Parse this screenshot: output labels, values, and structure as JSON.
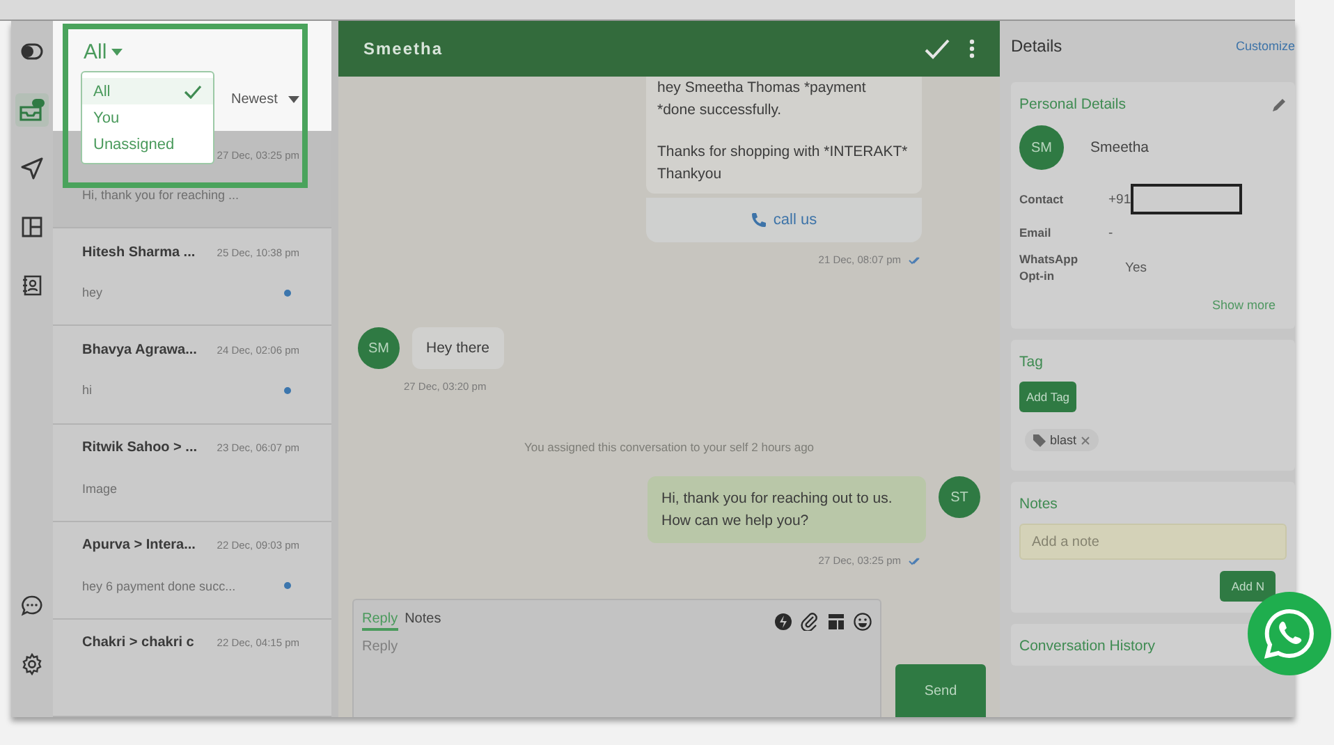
{
  "rail": [
    {
      "kind": "toggle",
      "selected": false
    },
    {
      "kind": "inbox",
      "selected": true
    },
    {
      "kind": "send",
      "selected": false
    },
    {
      "kind": "layout",
      "selected": false
    },
    {
      "kind": "contacts",
      "selected": false
    },
    {
      "kind": "chat",
      "selected": false
    },
    {
      "kind": "settings",
      "selected": false
    }
  ],
  "filter": {
    "label": "All",
    "options": [
      {
        "label": "All",
        "selected": true
      },
      {
        "label": "You",
        "selected": false
      },
      {
        "label": "Unassigned",
        "selected": false
      }
    ]
  },
  "sort": {
    "label": "Newest"
  },
  "conversations": [
    {
      "time": "27 Dec, 03:25 pm",
      "preview": "Hi, thank you for reaching ...",
      "unread": false,
      "selected": true
    },
    {
      "name": "Hitesh Sharma ...",
      "time": "25 Dec, 10:38 pm",
      "preview": "hey",
      "unread": true,
      "selected": false
    },
    {
      "name": "Bhavya Agrawa...",
      "time": "24 Dec, 02:06 pm",
      "preview": "hi",
      "unread": true,
      "selected": false
    },
    {
      "name": "Ritwik Sahoo > ...",
      "time": "23 Dec, 06:07 pm",
      "preview": "Image",
      "unread": false,
      "selected": false
    },
    {
      "name": "Apurva > Intera...",
      "time": "22 Dec, 09:03 pm",
      "preview": "hey 6 payment done succ...",
      "unread": true,
      "selected": false
    },
    {
      "name": "Chakri > chakri c",
      "time": "22 Dec, 04:15 pm",
      "unread": false,
      "selected": false
    }
  ],
  "chat": {
    "title": "Smeetha",
    "messages": [
      {
        "kind": "template",
        "paragraphs": [
          [
            "hey Smeetha Thomas *payment",
            "*done successfully."
          ],
          [
            "Thanks for shopping with *INTERAKT*",
            "Thankyou"
          ]
        ],
        "button": "call us",
        "time": "21 Dec, 08:07 pm"
      },
      {
        "kind": "incoming",
        "avatar": "SM",
        "text": "Hey there",
        "time": "27 Dec, 03:20 pm"
      },
      {
        "kind": "system",
        "text": "You assigned this conversation to your self 2 hours ago"
      },
      {
        "kind": "outgoing",
        "avatar": "ST",
        "text": "Hi, thank you for reaching out to us. How can we help you?",
        "time": "27 Dec, 03:25 pm"
      }
    ],
    "composer": {
      "tabs": [
        {
          "label": "Reply",
          "selected": true
        },
        {
          "label": "Notes",
          "selected": false
        }
      ],
      "placeholder": "Reply",
      "send": "Send"
    }
  },
  "details": {
    "title": "Details",
    "customize": "Customize",
    "personal": {
      "title": "Personal Details",
      "avatar": "SM",
      "name": "Smeetha",
      "fields": [
        {
          "label": "Contact",
          "value": "+91",
          "redacted": true
        },
        {
          "label": "Email",
          "value": "-",
          "redacted": false
        },
        {
          "label": "WhatsApp Opt-in",
          "value": "Yes",
          "redacted": false
        }
      ],
      "show_more": "Show more"
    },
    "tag": {
      "title": "Tag",
      "button": "Add Tag",
      "tags": [
        "blast"
      ]
    },
    "notes": {
      "title": "Notes",
      "placeholder": "Add a note",
      "button": "Add N"
    },
    "history": {
      "title": "Conversation History"
    }
  }
}
